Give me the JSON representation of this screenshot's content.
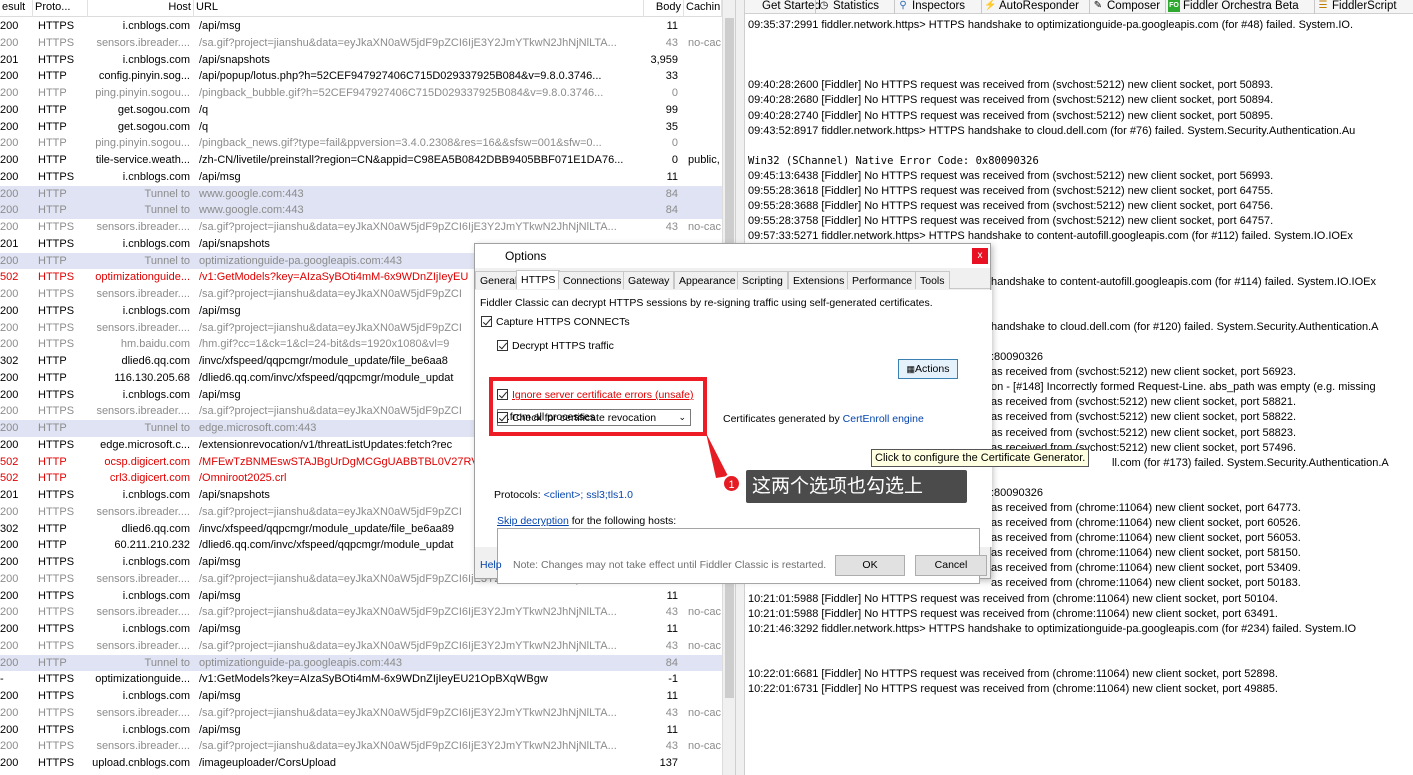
{
  "columns": {
    "result": "esult",
    "protocol": "Proto...",
    "host": "Host",
    "url": "URL",
    "body": "Body",
    "caching": "Cachin"
  },
  "sessions": [
    {
      "result": "200",
      "protocol": "HTTPS",
      "host": "i.cnblogs.com",
      "url": "/api/msg",
      "body": "11",
      "caching": "",
      "style": ""
    },
    {
      "result": "200",
      "protocol": "HTTPS",
      "host": "sensors.ibreader....",
      "url": "/sa.gif?project=jianshu&data=eyJkaXN0aW5jdF9pZCI6IjE3Y2JmYTkwN2JhNjNlLTA...",
      "body": "43",
      "caching": "no-cac",
      "style": "gray"
    },
    {
      "result": "201",
      "protocol": "HTTPS",
      "host": "i.cnblogs.com",
      "url": "/api/snapshots",
      "body": "3,959",
      "caching": "",
      "style": ""
    },
    {
      "result": "200",
      "protocol": "HTTP",
      "host": "config.pinyin.sog...",
      "url": "/api/popup/lotus.php?h=52CEF947927406C715D029337925B084&v=9.8.0.3746...",
      "body": "33",
      "caching": "",
      "style": ""
    },
    {
      "result": "200",
      "protocol": "HTTP",
      "host": "ping.pinyin.sogou...",
      "url": "/pingback_bubble.gif?h=52CEF947927406C715D029337925B084&v=9.8.0.3746...",
      "body": "0",
      "caching": "",
      "style": "gray"
    },
    {
      "result": "200",
      "protocol": "HTTP",
      "host": "get.sogou.com",
      "url": "/q",
      "body": "99",
      "caching": "",
      "style": ""
    },
    {
      "result": "200",
      "protocol": "HTTP",
      "host": "get.sogou.com",
      "url": "/q",
      "body": "35",
      "caching": "",
      "style": ""
    },
    {
      "result": "200",
      "protocol": "HTTP",
      "host": "ping.pinyin.sogou...",
      "url": "/pingback_news.gif?type=fail&ppversion=3.4.0.2308&res=16&&sfsw=001&sfw=0...",
      "body": "0",
      "caching": "",
      "style": "gray"
    },
    {
      "result": "200",
      "protocol": "HTTP",
      "host": "tile-service.weath...",
      "url": "/zh-CN/livetile/preinstall?region=CN&appid=C98EA5B0842DBB9405BBF071E1DA76...",
      "body": "0",
      "caching": "public,",
      "style": ""
    },
    {
      "result": "200",
      "protocol": "HTTPS",
      "host": "i.cnblogs.com",
      "url": "/api/msg",
      "body": "11",
      "caching": "",
      "style": ""
    },
    {
      "result": "200",
      "protocol": "HTTP",
      "host": "Tunnel to",
      "url": "www.google.com:443",
      "body": "84",
      "caching": "",
      "style": "gray sel"
    },
    {
      "result": "200",
      "protocol": "HTTP",
      "host": "Tunnel to",
      "url": "www.google.com:443",
      "body": "84",
      "caching": "",
      "style": "gray sel"
    },
    {
      "result": "200",
      "protocol": "HTTPS",
      "host": "sensors.ibreader....",
      "url": "/sa.gif?project=jianshu&data=eyJkaXN0aW5jdF9pZCI6IjE3Y2JmYTkwN2JhNjNlLTA...",
      "body": "43",
      "caching": "no-cac",
      "style": "gray"
    },
    {
      "result": "201",
      "protocol": "HTTPS",
      "host": "i.cnblogs.com",
      "url": "/api/snapshots",
      "body": "",
      "caching": "",
      "style": ""
    },
    {
      "result": "200",
      "protocol": "HTTP",
      "host": "Tunnel to",
      "url": "optimizationguide-pa.googleapis.com:443",
      "body": "",
      "caching": "",
      "style": "gray sel"
    },
    {
      "result": "502",
      "protocol": "HTTPS",
      "host": "optimizationguide...",
      "url": "/v1:GetModels?key=AIzaSyBOti4mM-6x9WDnZIjIeyEU",
      "body": "",
      "caching": "",
      "style": "red"
    },
    {
      "result": "200",
      "protocol": "HTTPS",
      "host": "sensors.ibreader....",
      "url": "/sa.gif?project=jianshu&data=eyJkaXN0aW5jdF9pZCI",
      "body": "",
      "caching": "",
      "style": "gray"
    },
    {
      "result": "200",
      "protocol": "HTTPS",
      "host": "i.cnblogs.com",
      "url": "/api/msg",
      "body": "",
      "caching": "",
      "style": ""
    },
    {
      "result": "200",
      "protocol": "HTTPS",
      "host": "sensors.ibreader....",
      "url": "/sa.gif?project=jianshu&data=eyJkaXN0aW5jdF9pZCI",
      "body": "",
      "caching": "",
      "style": "gray"
    },
    {
      "result": "200",
      "protocol": "HTTPS",
      "host": "hm.baidu.com",
      "url": "/hm.gif?cc=1&ck=1&cl=24-bit&ds=1920x1080&vl=9",
      "body": "",
      "caching": "",
      "style": "gray"
    },
    {
      "result": "302",
      "protocol": "HTTP",
      "host": "dlied6.qq.com",
      "url": "/invc/xfspeed/qqpcmgr/module_update/file_be6aa8",
      "body": "",
      "caching": "",
      "style": ""
    },
    {
      "result": "200",
      "protocol": "HTTP",
      "host": "116.130.205.68",
      "url": "/dlied6.qq.com/invc/xfspeed/qqpcmgr/module_updat",
      "body": "",
      "caching": "",
      "style": ""
    },
    {
      "result": "200",
      "protocol": "HTTPS",
      "host": "i.cnblogs.com",
      "url": "/api/msg",
      "body": "",
      "caching": "",
      "style": ""
    },
    {
      "result": "200",
      "protocol": "HTTPS",
      "host": "sensors.ibreader....",
      "url": "/sa.gif?project=jianshu&data=eyJkaXN0aW5jdF9pZCI",
      "body": "",
      "caching": "",
      "style": "gray"
    },
    {
      "result": "200",
      "protocol": "HTTP",
      "host": "Tunnel to",
      "url": "edge.microsoft.com:443",
      "body": "",
      "caching": "",
      "style": "gray sel"
    },
    {
      "result": "200",
      "protocol": "HTTPS",
      "host": "edge.microsoft.c...",
      "url": "/extensionrevocation/v1/threatListUpdates:fetch?rec",
      "body": "",
      "caching": "",
      "style": ""
    },
    {
      "result": "502",
      "protocol": "HTTP",
      "host": "ocsp.digicert.com",
      "url": "/MFEwTzBNMEswSTAJBgUrDgMCGgUABBTBL0V27RV",
      "body": "",
      "caching": "",
      "style": "red"
    },
    {
      "result": "502",
      "protocol": "HTTP",
      "host": "crl3.digicert.com",
      "url": "/Omniroot2025.crl",
      "body": "",
      "caching": "",
      "style": "red"
    },
    {
      "result": "201",
      "protocol": "HTTPS",
      "host": "i.cnblogs.com",
      "url": "/api/snapshots",
      "body": "",
      "caching": "",
      "style": ""
    },
    {
      "result": "200",
      "protocol": "HTTPS",
      "host": "sensors.ibreader....",
      "url": "/sa.gif?project=jianshu&data=eyJkaXN0aW5jdF9pZCI",
      "body": "",
      "caching": "",
      "style": "gray"
    },
    {
      "result": "302",
      "protocol": "HTTP",
      "host": "dlied6.qq.com",
      "url": "/invc/xfspeed/qqpcmgr/module_update/file_be6aa89",
      "body": "",
      "caching": "",
      "style": ""
    },
    {
      "result": "200",
      "protocol": "HTTP",
      "host": "60.211.210.232",
      "url": "/dlied6.qq.com/invc/xfspeed/qqpcmgr/module_updat",
      "body": "",
      "caching": "",
      "style": ""
    },
    {
      "result": "200",
      "protocol": "HTTPS",
      "host": "i.cnblogs.com",
      "url": "/api/msg",
      "body": "",
      "caching": "",
      "style": ""
    },
    {
      "result": "200",
      "protocol": "HTTPS",
      "host": "sensors.ibreader....",
      "url": "/sa.gif?project=jianshu&data=eyJkaXN0aW5jdF9pZCI6IjE3Y2JmYTkwN2JhNjNlLTA...",
      "body": "",
      "caching": "",
      "style": "gray"
    },
    {
      "result": "200",
      "protocol": "HTTPS",
      "host": "i.cnblogs.com",
      "url": "/api/msg",
      "body": "11",
      "caching": "",
      "style": ""
    },
    {
      "result": "200",
      "protocol": "HTTPS",
      "host": "sensors.ibreader....",
      "url": "/sa.gif?project=jianshu&data=eyJkaXN0aW5jdF9pZCI6IjE3Y2JmYTkwN2JhNjNlLTA...",
      "body": "43",
      "caching": "no-cac",
      "style": "gray"
    },
    {
      "result": "200",
      "protocol": "HTTPS",
      "host": "i.cnblogs.com",
      "url": "/api/msg",
      "body": "11",
      "caching": "",
      "style": ""
    },
    {
      "result": "200",
      "protocol": "HTTPS",
      "host": "sensors.ibreader....",
      "url": "/sa.gif?project=jianshu&data=eyJkaXN0aW5jdF9pZCI6IjE3Y2JmYTkwN2JhNjNlLTA...",
      "body": "43",
      "caching": "no-cac",
      "style": "gray"
    },
    {
      "result": "200",
      "protocol": "HTTP",
      "host": "Tunnel to",
      "url": "optimizationguide-pa.googleapis.com:443",
      "body": "84",
      "caching": "",
      "style": "gray sel"
    },
    {
      "result": "-",
      "protocol": "HTTPS",
      "host": "optimizationguide...",
      "url": "/v1:GetModels?key=AIzaSyBOti4mM-6x9WDnZIjIeyEU21OpBXqWBgw",
      "body": "-1",
      "caching": "",
      "style": ""
    },
    {
      "result": "200",
      "protocol": "HTTPS",
      "host": "i.cnblogs.com",
      "url": "/api/msg",
      "body": "11",
      "caching": "",
      "style": ""
    },
    {
      "result": "200",
      "protocol": "HTTPS",
      "host": "sensors.ibreader....",
      "url": "/sa.gif?project=jianshu&data=eyJkaXN0aW5jdF9pZCI6IjE3Y2JmYTkwN2JhNjNlLTA...",
      "body": "43",
      "caching": "no-cac",
      "style": "gray"
    },
    {
      "result": "200",
      "protocol": "HTTPS",
      "host": "i.cnblogs.com",
      "url": "/api/msg",
      "body": "11",
      "caching": "",
      "style": ""
    },
    {
      "result": "200",
      "protocol": "HTTPS",
      "host": "sensors.ibreader....",
      "url": "/sa.gif?project=jianshu&data=eyJkaXN0aW5jdF9pZCI6IjE3Y2JmYTkwN2JhNjNlLTA...",
      "body": "43",
      "caching": "no-cac",
      "style": "gray"
    },
    {
      "result": "200",
      "protocol": "HTTPS",
      "host": "upload.cnblogs.com",
      "url": "/imageuploader/CorsUpload",
      "body": "137",
      "caching": "",
      "style": ""
    }
  ],
  "tabs": [
    {
      "label": "Get Started",
      "icon": ""
    },
    {
      "label": "Statistics",
      "icon": "clock-icon"
    },
    {
      "label": "Inspectors",
      "icon": "magnifier-icon"
    },
    {
      "label": "AutoResponder",
      "icon": "lightning-icon"
    },
    {
      "label": "Composer",
      "icon": "pencil-icon"
    },
    {
      "label": "Fiddler Orchestra Beta",
      "icon": "fo-icon"
    },
    {
      "label": "FiddlerScript",
      "icon": "script-icon"
    }
  ],
  "log": [
    {
      "text": "09:35:37:2991 fiddler.network.https> HTTPS handshake to optimizationguide-pa.googleapis.com (for #48) failed. System.IO.",
      "mono": false
    },
    {
      "text": "",
      "mono": false
    },
    {
      "text": "",
      "mono": false
    },
    {
      "text": "",
      "mono": false
    },
    {
      "text": "09:40:28:2600 [Fiddler] No HTTPS request was received from (svchost:5212) new client socket, port 50893.",
      "mono": false
    },
    {
      "text": "09:40:28:2680 [Fiddler] No HTTPS request was received from (svchost:5212) new client socket, port 50894.",
      "mono": false
    },
    {
      "text": "09:40:28:2740 [Fiddler] No HTTPS request was received from (svchost:5212) new client socket, port 50895.",
      "mono": false
    },
    {
      "text": "09:43:52:8917 fiddler.network.https> HTTPS handshake to cloud.dell.com (for #76) failed. System.Security.Authentication.Au",
      "mono": false
    },
    {
      "text": "",
      "mono": false
    },
    {
      "text": "Win32 (SChannel) Native Error Code: 0x80090326",
      "mono": true
    },
    {
      "text": "09:45:13:6438 [Fiddler] No HTTPS request was received from (svchost:5212) new client socket, port 56993.",
      "mono": false
    },
    {
      "text": "09:55:28:3618 [Fiddler] No HTTPS request was received from (svchost:5212) new client socket, port 64755.",
      "mono": false
    },
    {
      "text": "09:55:28:3688 [Fiddler] No HTTPS request was received from (svchost:5212) new client socket, port 64756.",
      "mono": false
    },
    {
      "text": "09:55:28:3758 [Fiddler] No HTTPS request was received from (svchost:5212) new client socket, port 64757.",
      "mono": false
    },
    {
      "text": "09:57:33:5271 fiddler.network.https> HTTPS handshake to content-autofill.googleapis.com (for #112) failed. System.IO.IOEx",
      "mono": false
    },
    {
      "text": "",
      "mono": false
    },
    {
      "text": "",
      "mono": false
    },
    {
      "text": "handshake to content-autofill.googleapis.com (for #114) failed. System.IO.IOEx",
      "mono": false,
      "indent": true
    },
    {
      "text": "",
      "mono": false
    },
    {
      "text": "",
      "mono": false
    },
    {
      "text": "handshake to cloud.dell.com (for #120) failed. System.Security.Authentication.A",
      "mono": false,
      "indent": true
    },
    {
      "text": "",
      "mono": false
    },
    {
      "text": ":80090326",
      "mono": false,
      "indent": true
    },
    {
      "text": "as received from (svchost:5212) new client socket, port 56923.",
      "mono": false,
      "indent": true
    },
    {
      "text": "on - [#148] Incorrectly formed Request-Line. abs_path was empty (e.g. missing",
      "mono": false,
      "indent": true
    },
    {
      "text": "as received from (svchost:5212) new client socket, port 58821.",
      "mono": false,
      "indent": true
    },
    {
      "text": "as received from (svchost:5212) new client socket, port 58822.",
      "mono": false,
      "indent": true
    },
    {
      "text": "as received from (svchost:5212) new client socket, port 58823.",
      "mono": false,
      "indent": true
    },
    {
      "text": "as received from (svchost:5212) new client socket, port 57496.",
      "mono": false,
      "indent": true
    },
    {
      "text": "ll.com (for #173) failed. System.Security.Authentication.A",
      "mono": false,
      "indent2": true
    },
    {
      "text": "",
      "mono": false
    },
    {
      "text": ":80090326",
      "mono": false,
      "indent": true
    },
    {
      "text": "as received from (chrome:11064) new client socket, port 64773.",
      "mono": false,
      "indent": true
    },
    {
      "text": "as received from (chrome:11064) new client socket, port 60526.",
      "mono": false,
      "indent": true
    },
    {
      "text": "as received from (chrome:11064) new client socket, port 56053.",
      "mono": false,
      "indent": true
    },
    {
      "text": "as received from (chrome:11064) new client socket, port 58150.",
      "mono": false,
      "indent": true
    },
    {
      "text": "as received from (chrome:11064) new client socket, port 53409.",
      "mono": false,
      "indent": true
    },
    {
      "text": "as received from (chrome:11064) new client socket, port 50183.",
      "mono": false,
      "indent": true
    },
    {
      "text": "10:21:01:5988 [Fiddler] No HTTPS request was received from (chrome:11064) new client socket, port 50104.",
      "mono": false
    },
    {
      "text": "10:21:01:5988 [Fiddler] No HTTPS request was received from (chrome:11064) new client socket, port 63491.",
      "mono": false
    },
    {
      "text": "10:21:46:3292 fiddler.network.https> HTTPS handshake to optimizationguide-pa.googleapis.com (for #234) failed. System.IO",
      "mono": false
    },
    {
      "text": "",
      "mono": false
    },
    {
      "text": "",
      "mono": false
    },
    {
      "text": "10:22:01:6681 [Fiddler] No HTTPS request was received from (chrome:11064) new client socket, port 52898.",
      "mono": false
    },
    {
      "text": "10:22:01:6731 [Fiddler] No HTTPS request was received from (chrome:11064) new client socket, port 49885.",
      "mono": false
    }
  ],
  "dialog": {
    "title": "Options",
    "close": "x",
    "tabs": [
      "General",
      "HTTPS",
      "Connections",
      "Gateway",
      "Appearance",
      "Scripting",
      "Extensions",
      "Performance",
      "Tools"
    ],
    "active_tab": "HTTPS",
    "description": "Fiddler Classic can decrypt HTTPS sessions by re-signing traffic using self-generated certificates.",
    "capture_label": "Capture HTTPS CONNECTs",
    "decrypt_label": "Decrypt HTTPS traffic",
    "process_filter": "...from all processes",
    "certs_prefix": "Certificates generated by ",
    "certs_link": "CertEnroll engine",
    "actions_label": "Actions",
    "ignore_errors_label": "Ignore server certificate errors (unsafe)",
    "revocation_label": "Check for certificate revocation",
    "protocols_prefix": "Protocols: ",
    "protocols_value": "<client>; ssl3;tls1.0",
    "skip_link": "Skip decryption",
    "skip_suffix": " for the following hosts:",
    "help": "Help",
    "note": "Note: Changes may not take effect until Fiddler Classic is restarted.",
    "ok": "OK",
    "cancel": "Cancel"
  },
  "tooltip": "Click to configure the Certificate Generator.",
  "annotation": {
    "badge": "1",
    "text": "这两个选项也勾选上"
  },
  "colors": {
    "error_red": "#e00000",
    "highlight_red": "#ee1c24",
    "selected_row": "#dfe3f3",
    "link_blue": "#0645ad"
  }
}
